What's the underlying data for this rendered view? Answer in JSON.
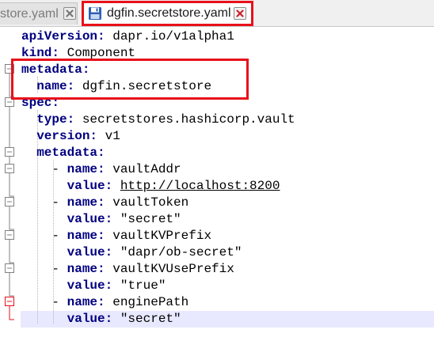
{
  "tabs": [
    {
      "label": "store.yaml",
      "active": false,
      "icon": "close-icon"
    },
    {
      "label": "dgfin.secretstore.yaml",
      "active": true,
      "icon": "save-disk-icon"
    }
  ],
  "editor": {
    "lines": [
      {
        "indent": "",
        "key": "apiVersion",
        "value": "dapr.io/v1alpha1"
      },
      {
        "indent": "",
        "key": "kind",
        "value": "Component"
      },
      {
        "indent": "",
        "key": "metadata",
        "value": ""
      },
      {
        "indent": "  ",
        "key": "name",
        "value": "dgfin.secretstore"
      },
      {
        "indent": "",
        "key": "spec",
        "value": ""
      },
      {
        "indent": "  ",
        "key": "type",
        "value": "secretstores.hashicorp.vault"
      },
      {
        "indent": "  ",
        "key": "version",
        "value": "v1"
      },
      {
        "indent": "  ",
        "key": "metadata",
        "value": ""
      },
      {
        "indent": "    - ",
        "key": "name",
        "value": "vaultAddr"
      },
      {
        "indent": "      ",
        "key": "value",
        "value": "http://localhost:8200",
        "link": true
      },
      {
        "indent": "    - ",
        "key": "name",
        "value": "vaultToken"
      },
      {
        "indent": "      ",
        "key": "value",
        "value": "\"secret\""
      },
      {
        "indent": "    - ",
        "key": "name",
        "value": "vaultKVPrefix"
      },
      {
        "indent": "      ",
        "key": "value",
        "value": "\"dapr/ob-secret\""
      },
      {
        "indent": "    - ",
        "key": "name",
        "value": "vaultKVUsePrefix"
      },
      {
        "indent": "      ",
        "key": "value",
        "value": "\"true\""
      },
      {
        "indent": "    - ",
        "key": "name",
        "value": "enginePath"
      },
      {
        "indent": "      ",
        "key": "value",
        "value": "\"secret\""
      }
    ]
  },
  "colors": {
    "key": "#000080",
    "highlight": "#e8101a",
    "current_line": "#e8e8ff",
    "fold_marker": "#808080",
    "fold_marker_active": "#e8101a"
  }
}
